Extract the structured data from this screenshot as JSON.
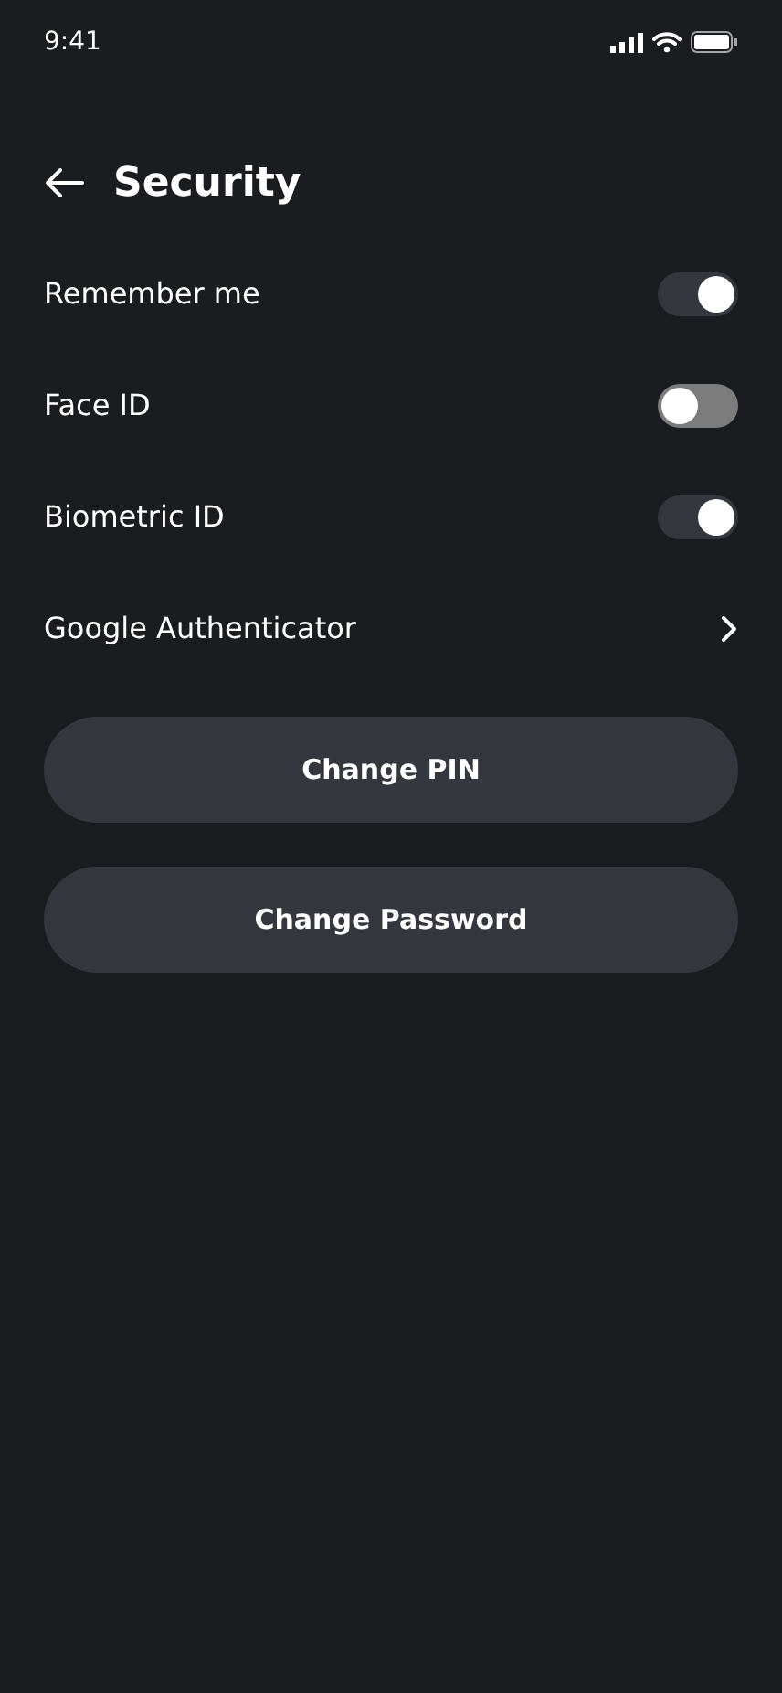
{
  "status_bar": {
    "time": "9:41"
  },
  "header": {
    "title": "Security"
  },
  "settings": [
    {
      "kind": "toggle",
      "label": "Remember me",
      "on": true
    },
    {
      "kind": "toggle",
      "label": "Face ID",
      "on": false
    },
    {
      "kind": "toggle",
      "label": "Biometric ID",
      "on": true
    },
    {
      "kind": "link",
      "label": "Google Authenticator"
    }
  ],
  "buttons": [
    "Change PIN",
    "Change Password"
  ]
}
